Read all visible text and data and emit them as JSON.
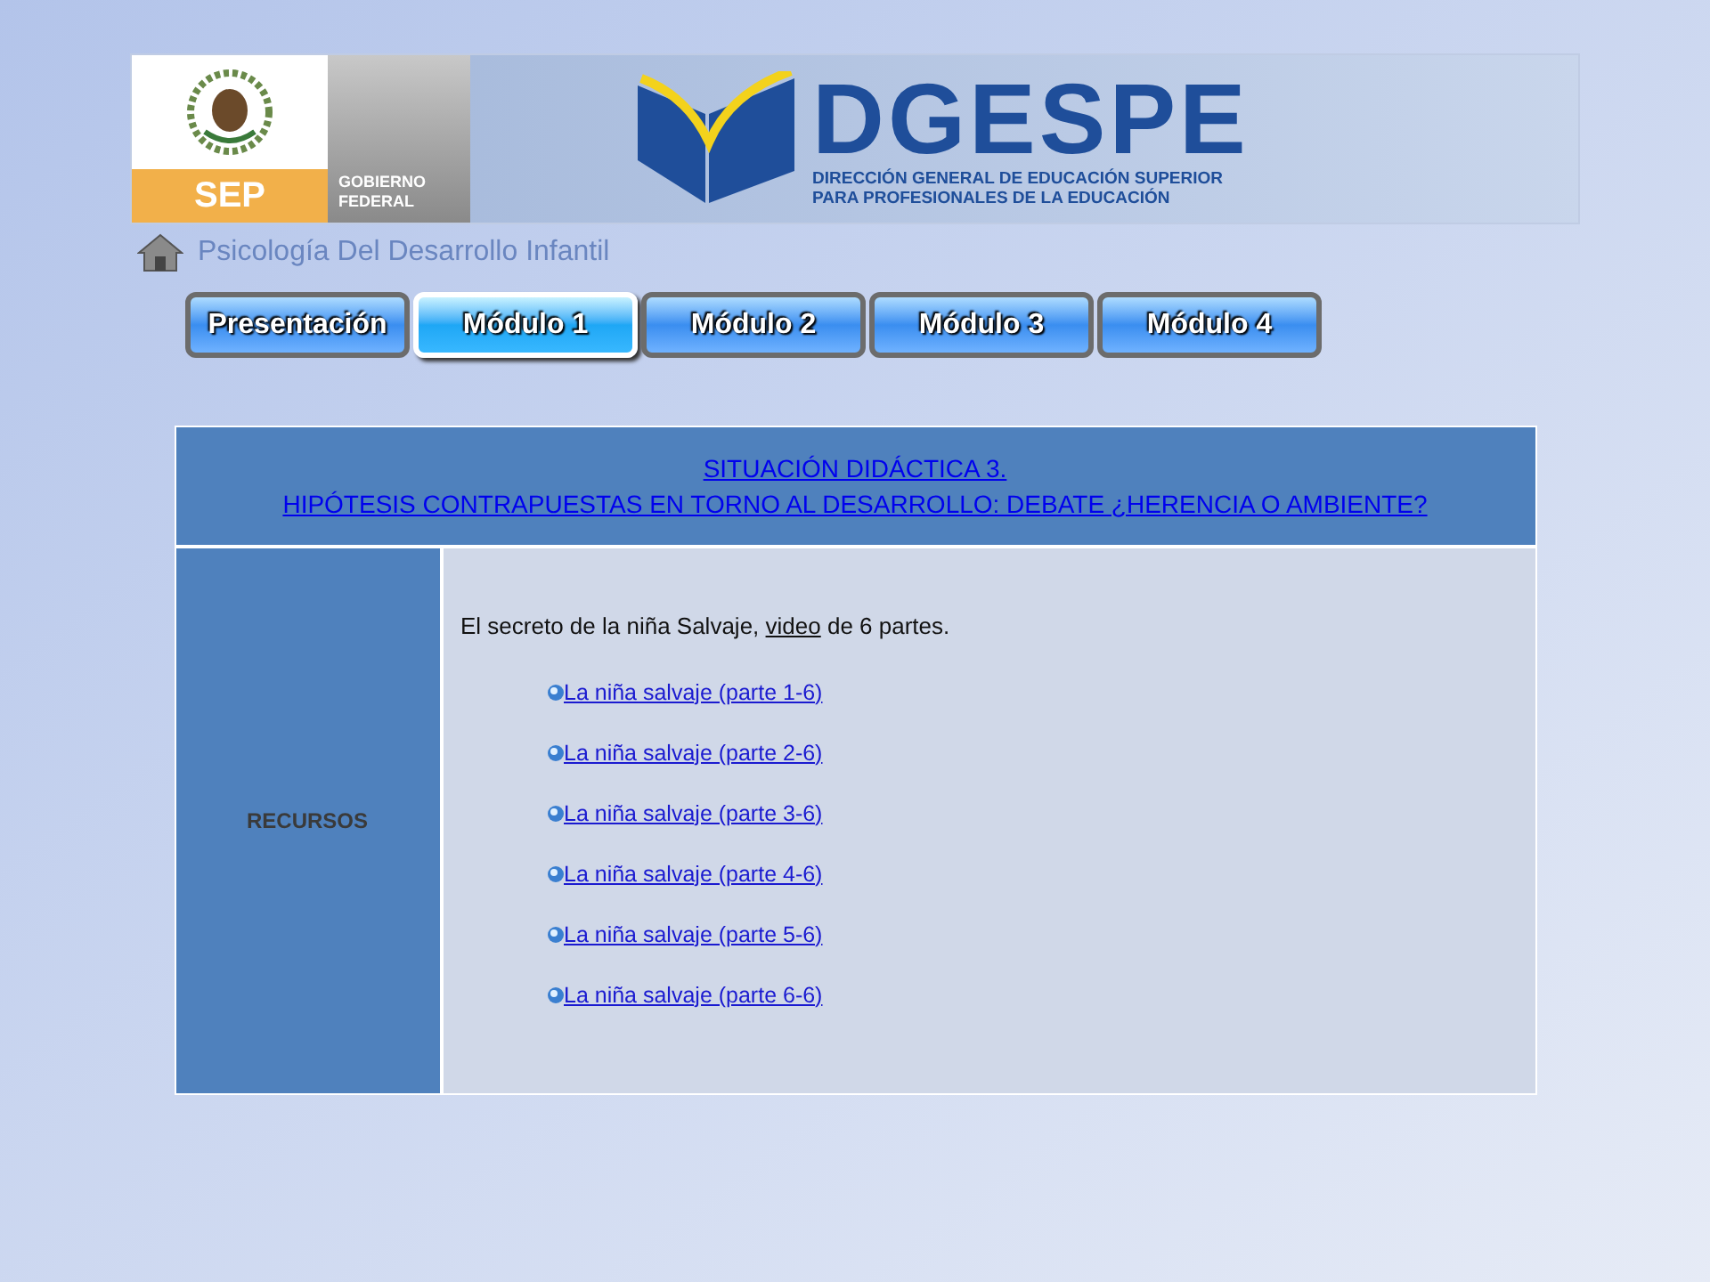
{
  "banner": {
    "sep": "SEP",
    "gobierno": [
      "GOBIERNO",
      "FEDERAL"
    ],
    "logo_text": "DGESPE",
    "subtitle": [
      "DIRECCIÓN GENERAL DE EDUCACIÓN SUPERIOR",
      "PARA PROFESIONALES DE LA EDUCACIÓN"
    ]
  },
  "breadcrumb": "Psicología Del Desarrollo Infantil",
  "tabs": [
    {
      "label": "Presentación",
      "selected": false
    },
    {
      "label": "Módulo 1",
      "selected": true
    },
    {
      "label": "Módulo 2",
      "selected": false
    },
    {
      "label": "Módulo 3",
      "selected": false
    },
    {
      "label": "Módulo 4",
      "selected": false
    }
  ],
  "table": {
    "title": [
      "SITUACIÓN DIDÁCTICA 3.",
      "HIPÓTESIS CONTRAPUESTAS EN TORNO AL DESARROLLO: DEBATE ¿HERENCIA O AMBIENTE?"
    ],
    "row_label": "RECURSOS",
    "intro": {
      "before": "El secreto de la niña Salvaje, ",
      "link": "video",
      "after": " de 6 partes."
    },
    "links": [
      "La niña salvaje (parte 1-6)",
      "La niña salvaje (parte 2-6)",
      "La niña salvaje (parte 3-6)",
      "La niña salvaje (parte 4-6)",
      "La niña salvaje (parte 5-6)",
      "La niña salvaje (parte 6-6)"
    ]
  }
}
